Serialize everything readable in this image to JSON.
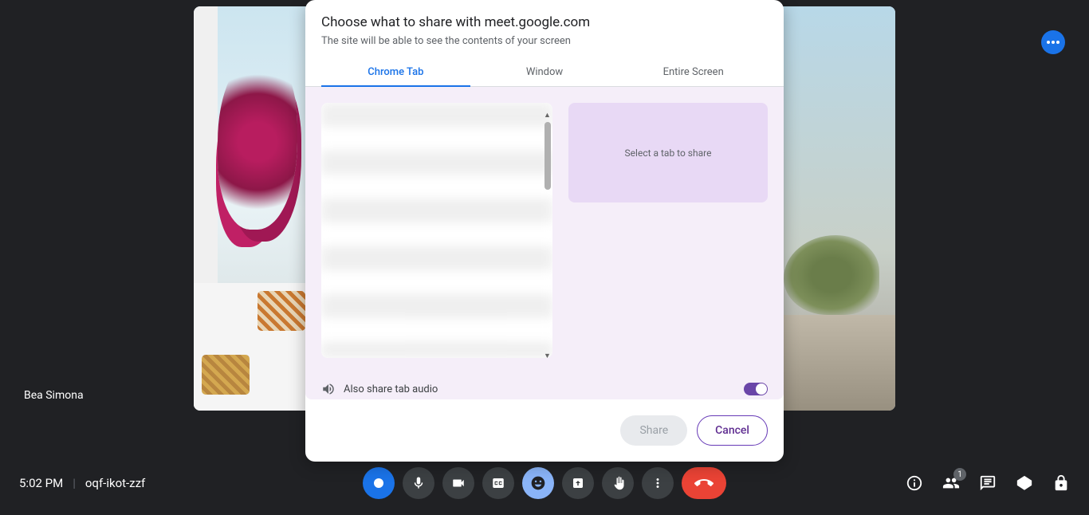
{
  "participant": {
    "name": "Bea Simona"
  },
  "dialog": {
    "title": "Choose what to share with meet.google.com",
    "subtitle": "The site will be able to see the contents of your screen",
    "tabs": {
      "chrome_tab": "Chrome Tab",
      "window": "Window",
      "entire_screen": "Entire Screen"
    },
    "preview_placeholder": "Select a tab to share",
    "audio_label": "Also share tab audio",
    "audio_enabled": true,
    "buttons": {
      "share": "Share",
      "cancel": "Cancel"
    }
  },
  "bottom_bar": {
    "time": "5:02 PM",
    "meeting_code": "oqf-ikot-zzf",
    "people_badge": "1"
  }
}
